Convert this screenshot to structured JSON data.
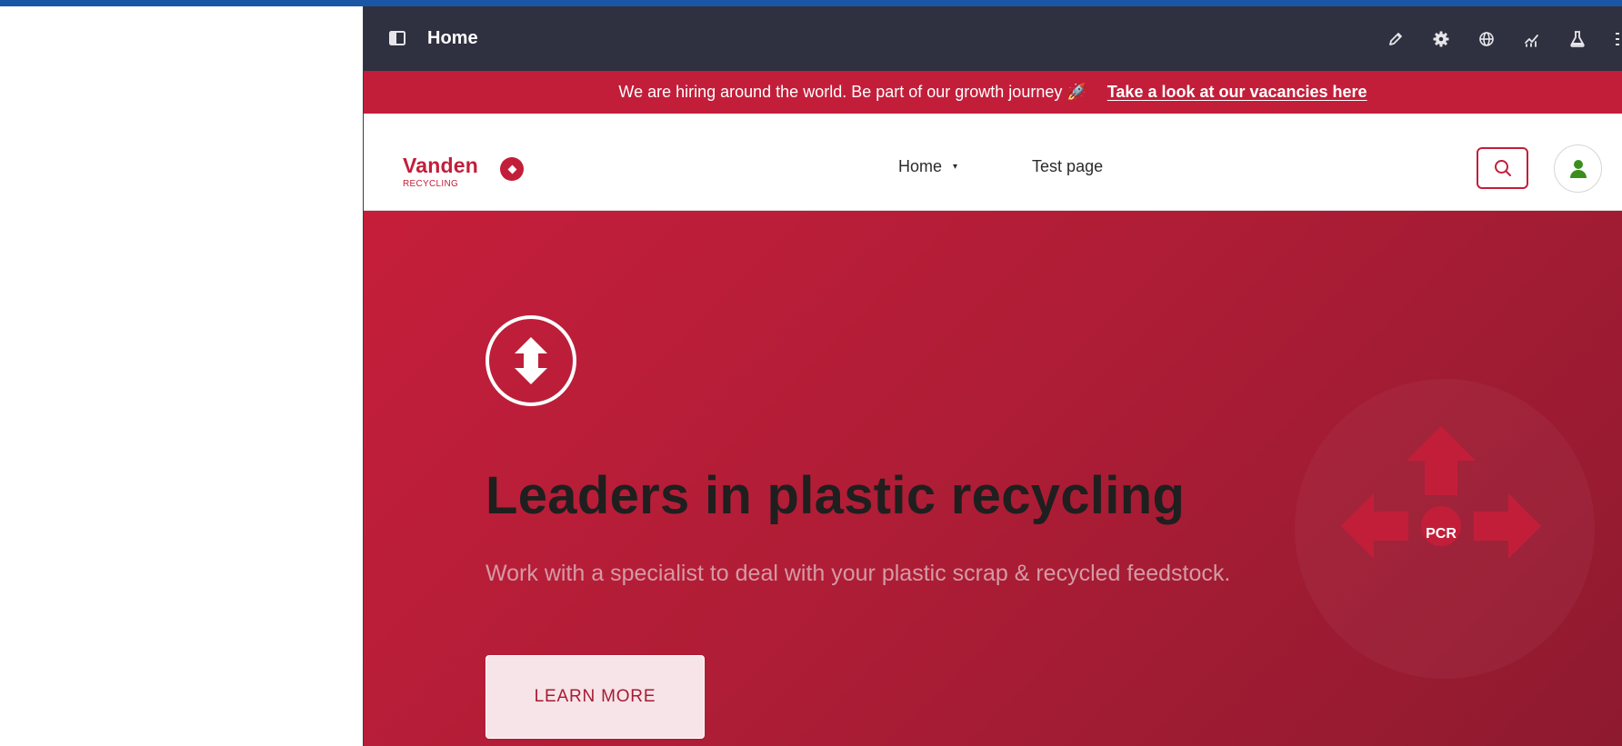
{
  "toolbar": {
    "title": "Home",
    "icons": [
      "sidebar-toggle-icon",
      "pencil-icon",
      "gear-icon",
      "globe-icon",
      "analytics-icon",
      "flask-icon",
      "more-icon"
    ]
  },
  "announcement": {
    "text": "We are hiring around the world. Be part of our growth journey 🚀",
    "link": "Take a look at our vacancies here"
  },
  "header": {
    "logo_name": "Vanden",
    "logo_sub": "RECYCLING",
    "nav": [
      {
        "label": "Home",
        "caret": "▾"
      },
      {
        "label": "Test page"
      }
    ]
  },
  "hero": {
    "title": "Leaders in plastic recycling",
    "subtitle": "Work with a specialist to deal with your plastic scrap & recycled feedstock.",
    "cta": "LEARN MORE",
    "graphic_label": "PCR"
  },
  "colors": {
    "brand_red": "#c21e3a",
    "toolbar_bg": "#2f3140",
    "top_strip": "#1b56a6",
    "user_icon": "#3a8f1c"
  }
}
